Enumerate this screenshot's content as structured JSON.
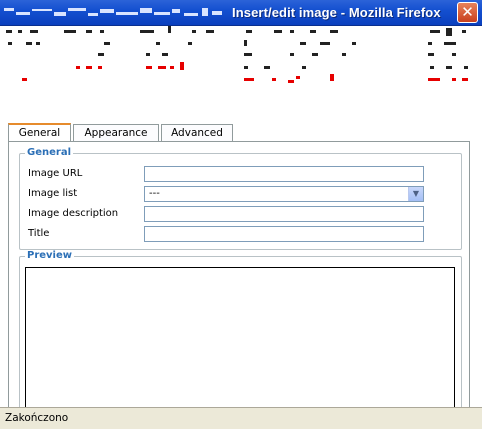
{
  "window": {
    "title": "Insert/edit image - Mozilla Firefox",
    "close_glyph": "✕"
  },
  "tabs": [
    {
      "label": "General",
      "active": true
    },
    {
      "label": "Appearance",
      "active": false
    },
    {
      "label": "Advanced",
      "active": false
    }
  ],
  "general": {
    "legend": "General",
    "fields": [
      {
        "label": "Image URL",
        "value": ""
      },
      {
        "label": "Image list",
        "value": "---"
      },
      {
        "label": "Image description",
        "value": ""
      },
      {
        "label": "Title",
        "value": ""
      }
    ]
  },
  "preview": {
    "legend": "Preview"
  },
  "status": {
    "text": "Zakończono"
  },
  "colors": {
    "titlebar": "#1450d0",
    "legend": "#2b6fb6",
    "active_tab_accent": "#e68b2c",
    "scramble_red": "#e60000"
  }
}
